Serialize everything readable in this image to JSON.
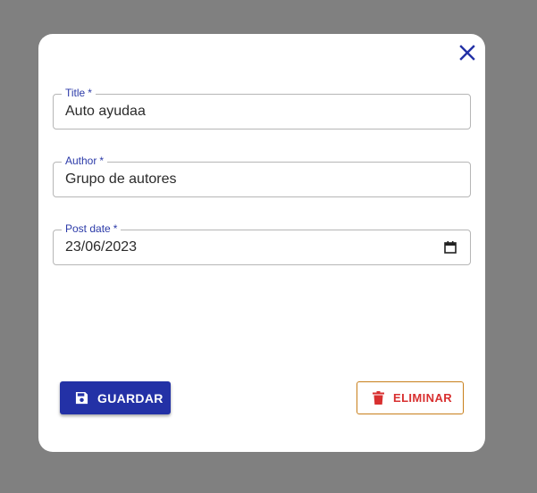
{
  "colors": {
    "backdrop": "#808080",
    "accent": "#2331a6",
    "danger": "#d83030",
    "danger_border": "#c87f1a"
  },
  "dialog": {
    "close_icon": "close-icon",
    "fields": {
      "title": {
        "label": "Title",
        "required_mark": "*",
        "value": "Auto ayudaa"
      },
      "author": {
        "label": "Author",
        "required_mark": "*",
        "value": "Grupo de autores"
      },
      "post_date": {
        "label": "Post date",
        "required_mark": "*",
        "value": "23/06/2023",
        "icon": "calendar-icon"
      }
    },
    "actions": {
      "save": {
        "label": "GUARDAR",
        "icon": "save-icon"
      },
      "delete": {
        "label": "ELIMINAR",
        "icon": "trash-icon"
      }
    }
  }
}
